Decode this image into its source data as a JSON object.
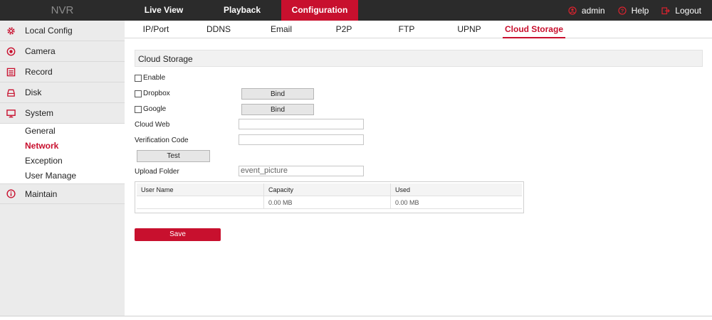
{
  "brand": "NVR",
  "topnav": [
    {
      "label": "Live View"
    },
    {
      "label": "Playback"
    },
    {
      "label": "Configuration"
    }
  ],
  "topright": {
    "user": "admin",
    "help": "Help",
    "logout": "Logout"
  },
  "sidebar": {
    "items": [
      {
        "label": "Local Config",
        "icon": "gear-icon"
      },
      {
        "label": "Camera",
        "icon": "camera-icon"
      },
      {
        "label": "Record",
        "icon": "record-icon"
      },
      {
        "label": "Disk",
        "icon": "disk-icon"
      },
      {
        "label": "System",
        "icon": "monitor-icon"
      }
    ],
    "submenu": [
      {
        "label": "General"
      },
      {
        "label": "Network"
      },
      {
        "label": "Exception"
      },
      {
        "label": "User Manage"
      }
    ],
    "maintain": {
      "label": "Maintain",
      "icon": "info-icon"
    }
  },
  "tabs": [
    {
      "label": "IP/Port"
    },
    {
      "label": "DDNS"
    },
    {
      "label": "Email"
    },
    {
      "label": "P2P"
    },
    {
      "label": "FTP"
    },
    {
      "label": "UPNP"
    },
    {
      "label": "Cloud Storage"
    }
  ],
  "cloud": {
    "section_title": "Cloud Storage",
    "enable_label": "Enable",
    "dropbox_label": "Dropbox",
    "google_label": "Google",
    "bind_label": "Bind",
    "cloud_web_label": "Cloud Web",
    "cloud_web_value": "",
    "verification_label": "Verification Code",
    "verification_value": "",
    "test_label": "Test",
    "upload_folder_label": "Upload Folder",
    "upload_folder_value": "event_picture",
    "table": {
      "headers": [
        "User Name",
        "Capacity",
        "Used"
      ],
      "rows": [
        [
          "",
          "0.00 MB",
          "0.00 MB"
        ]
      ]
    },
    "save_label": "Save"
  },
  "colors": {
    "accent": "#c8102e",
    "topbar": "#2b2b2b",
    "sidebar": "#ebebeb"
  }
}
